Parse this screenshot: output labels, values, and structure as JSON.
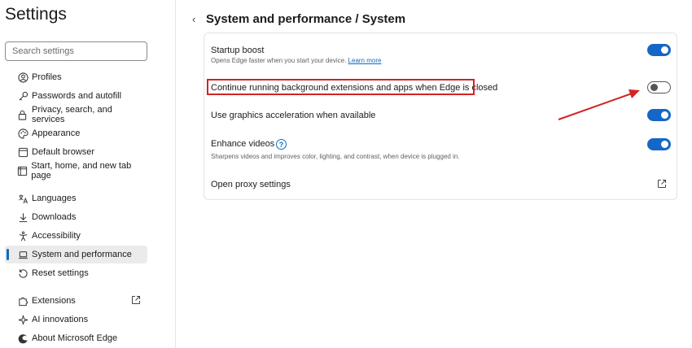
{
  "app": {
    "title": "Settings"
  },
  "search": {
    "placeholder": "Search settings"
  },
  "sidebar": {
    "items": [
      {
        "label": "Profiles",
        "icon": "profile-icon"
      },
      {
        "label": "Passwords and autofill",
        "icon": "key-icon"
      },
      {
        "label": "Privacy, search, and services",
        "icon": "lock-icon"
      },
      {
        "label": "Appearance",
        "icon": "palette-icon"
      },
      {
        "label": "Default browser",
        "icon": "browser-icon"
      },
      {
        "label": "Start, home, and new tab page",
        "icon": "home-page-icon"
      },
      {
        "label": "Languages",
        "icon": "languages-icon"
      },
      {
        "label": "Downloads",
        "icon": "download-icon"
      },
      {
        "label": "Accessibility",
        "icon": "accessibility-icon"
      },
      {
        "label": "System and performance",
        "icon": "laptop-icon",
        "active": true
      },
      {
        "label": "Reset settings",
        "icon": "reset-icon"
      },
      {
        "label": "Extensions",
        "icon": "puzzle-icon",
        "external": true
      },
      {
        "label": "AI innovations",
        "icon": "sparkle-icon"
      },
      {
        "label": "About Microsoft Edge",
        "icon": "edge-logo-icon"
      }
    ]
  },
  "main": {
    "breadcrumb": "System and performance / System",
    "settings": [
      {
        "title": "Startup boost",
        "subtitle": "Opens Edge faster when you start your device.",
        "link": "Learn more",
        "enabled": true
      },
      {
        "title": "Continue running background extensions and apps when Edge is closed",
        "enabled": false,
        "highlighted": true
      },
      {
        "title": "Use graphics acceleration when available",
        "enabled": true
      },
      {
        "title": "Enhance videos",
        "subtitle": "Sharpens videos and improves color, lighting, and contrast, when device is plugged in.",
        "help": "?",
        "enabled": true
      },
      {
        "title": "Open proxy settings",
        "external": true
      }
    ]
  },
  "colors": {
    "accent": "#1567c7",
    "annotation": "#d22424"
  }
}
